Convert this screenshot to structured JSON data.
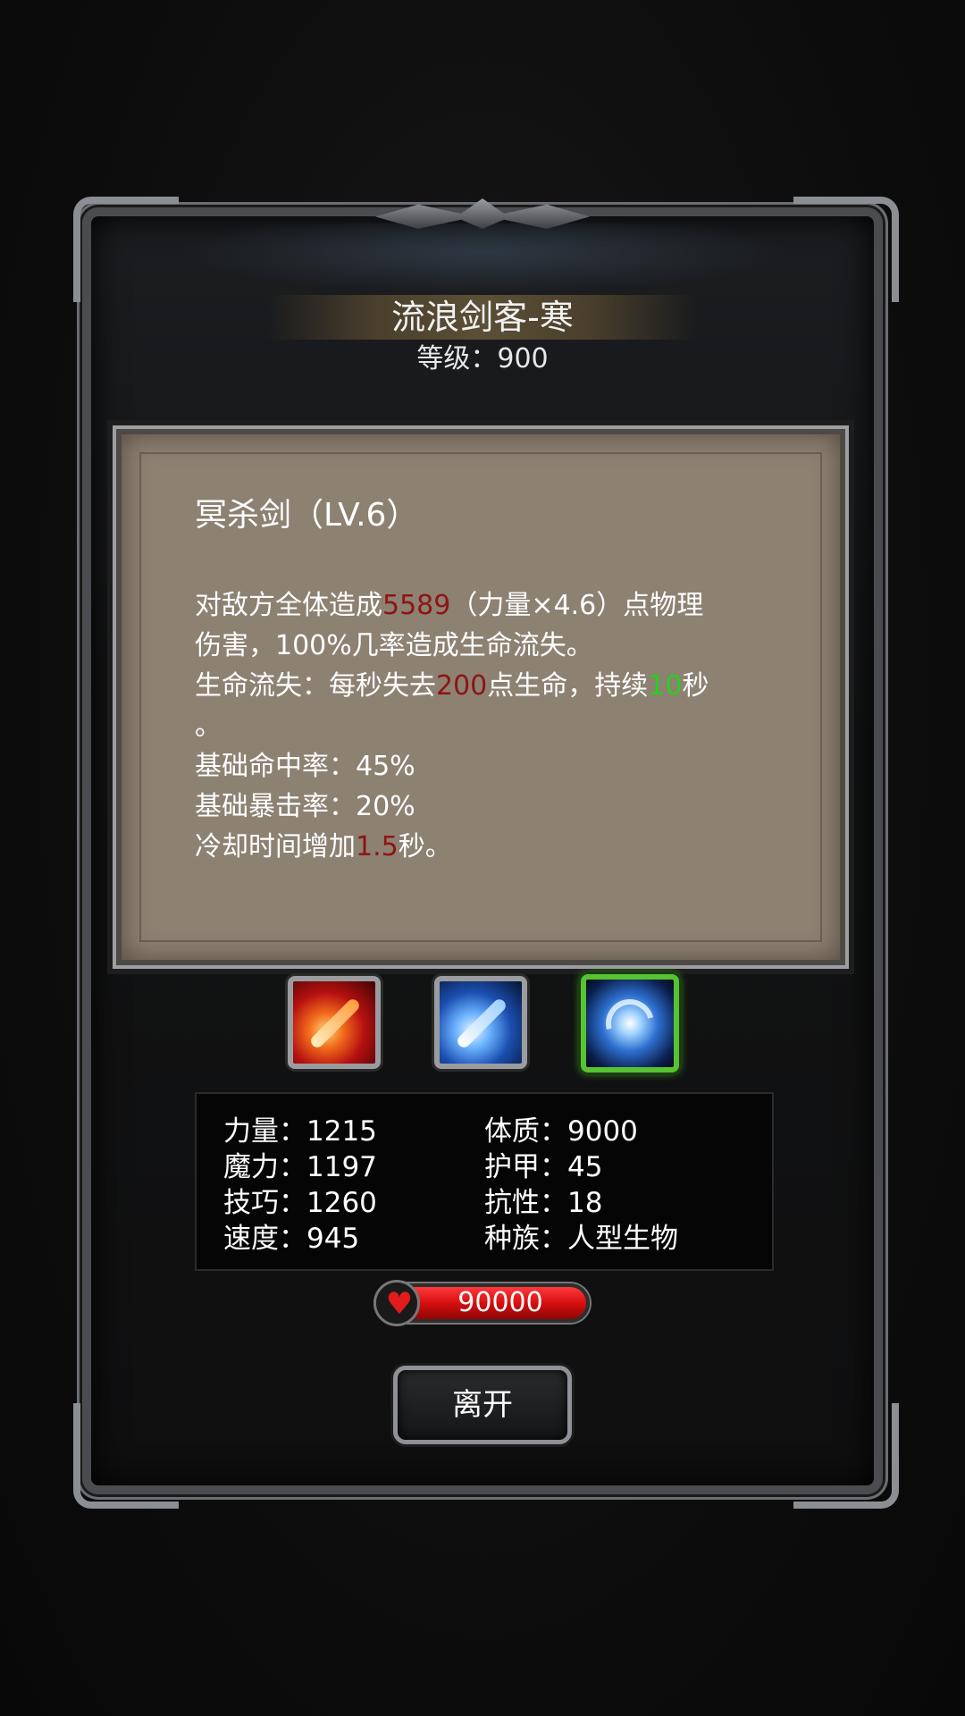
{
  "monster": {
    "name": "流浪剑客-寒",
    "level_text": "等级：900"
  },
  "skill": {
    "name": "冥杀剑（LV.6）",
    "desc": {
      "l1_pre": "对敌方全体造成",
      "l1_damage": "5589",
      "l1_post": "（力量×4.6）点物理",
      "l2": "伤害，100%几率造成生命流失。",
      "l3_pre": "生命流失：每秒失去",
      "l3_hp": "200",
      "l3_mid": "点生命，持续",
      "l3_dur": "10",
      "l3_post": "秒",
      "l4": "。",
      "l5": "基础命中率：45%",
      "l6": "基础暴击率：20%",
      "l7_pre": "冷却时间增加",
      "l7_val": "1.5",
      "l7_post": "秒。"
    }
  },
  "skill_icons": [
    {
      "name": "red-slash-icon",
      "selected": false
    },
    {
      "name": "blue-slash-icon",
      "selected": false
    },
    {
      "name": "blue-vortex-icon",
      "selected": true
    }
  ],
  "stats": {
    "strength": "力量：1215",
    "magic": "魔力：1197",
    "skill": "技巧：1260",
    "speed": "速度：945",
    "constitution": "体质：9000",
    "armor": "护甲：45",
    "resistance": "抗性：18",
    "race": "种族：人型生物"
  },
  "hp": {
    "value": "90000",
    "icon": "heart-icon"
  },
  "buttons": {
    "leave": "离开"
  },
  "colors": {
    "highlight_red": "#8e1414",
    "highlight_green": "#23d21e",
    "selected_border": "#57c232"
  }
}
